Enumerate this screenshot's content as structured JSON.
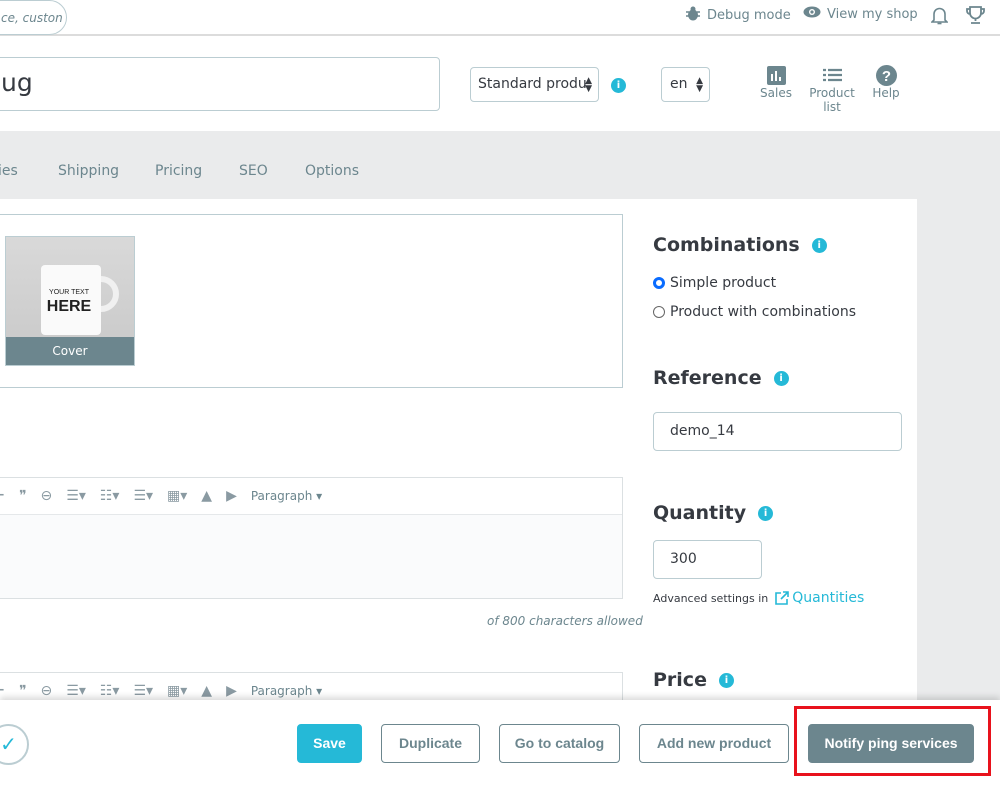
{
  "header": {
    "search_placeholder": "ce, custon",
    "debug_mode": "Debug mode",
    "view_shop": "View my shop"
  },
  "product": {
    "name": "ug",
    "type_select": "Standard produ",
    "lang_select": "en"
  },
  "toolbar_buttons": {
    "sales": "Sales",
    "product_list": "Product list",
    "help": "Help"
  },
  "tabs": [
    "ies",
    "Shipping",
    "Pricing",
    "SEO",
    "Options"
  ],
  "images": {
    "cover_label": "Cover",
    "mug_text": "YOUR TEXT HERE"
  },
  "editor": {
    "format_select": "Paragraph",
    "char_count": "of 800 characters allowed"
  },
  "combinations": {
    "title": "Combinations",
    "options": [
      {
        "label": "Simple product",
        "selected": true
      },
      {
        "label": "Product with combinations",
        "selected": false
      }
    ]
  },
  "reference": {
    "title": "Reference",
    "value": "demo_14"
  },
  "quantity": {
    "title": "Quantity",
    "value": "300",
    "advanced_text": "Advanced settings in",
    "link": "Quantities"
  },
  "price": {
    "title": "Price"
  },
  "footer": {
    "save": "Save",
    "duplicate": "Duplicate",
    "go_to_catalog": "Go to catalog",
    "add_new": "Add new product",
    "notify": "Notify ping services"
  },
  "colors": {
    "accent": "#25b9d7",
    "secondary": "#6c868e",
    "highlight": "#e8121c"
  }
}
